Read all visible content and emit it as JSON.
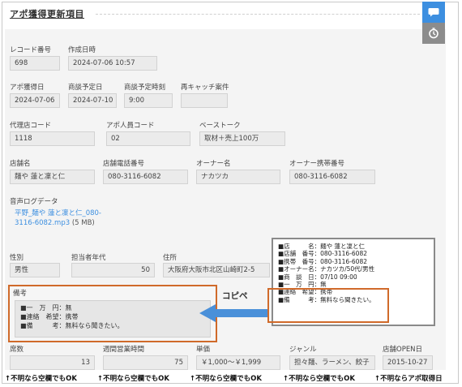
{
  "header": {
    "title": "アポ獲得更新項目"
  },
  "side_buttons": [
    {
      "icon": "chat-bubble-icon",
      "color": "#3d8fe0"
    },
    {
      "icon": "timer-icon",
      "color": "#8c8c8c"
    }
  ],
  "fields": {
    "record_no": {
      "label": "レコード番号",
      "value": "698"
    },
    "created_at": {
      "label": "作成日時",
      "value": "2024-07-06 10:57"
    },
    "appo_date": {
      "label": "アポ獲得日",
      "value": "2024-07-06"
    },
    "meeting_date": {
      "label": "商談予定日",
      "value": "2024-07-10"
    },
    "meeting_time": {
      "label": "商談予定時刻",
      "value": "9:00"
    },
    "recatch": {
      "label": "再キャッチ案件",
      "value": ""
    },
    "agency_code": {
      "label": "代理店コード",
      "value": "1118"
    },
    "appointer_code": {
      "label": "アポ人員コード",
      "value": "02"
    },
    "base_talk": {
      "label": "ベーストーク",
      "value": "取材＋売上100万"
    },
    "shop_name": {
      "label": "店舗名",
      "value": "麺や 蓮と凜と仁"
    },
    "shop_phone": {
      "label": "店舗電話番号",
      "value": "080-3116-6082"
    },
    "owner_name": {
      "label": "オーナー名",
      "value": "ナカツカ"
    },
    "owner_mobile": {
      "label": "オーナー携帯番号",
      "value": "080-3116-6082"
    },
    "audio": {
      "label": "音声ログデータ",
      "link": "平野_麺や 蓮と凜と仁_080-3116-6082.mp3",
      "size": "(5 MB)"
    },
    "gender": {
      "label": "性別",
      "value": "男性"
    },
    "age": {
      "label": "担当者年代",
      "value": "50"
    },
    "address": {
      "label": "住所",
      "value": "大阪府大阪市北区山崎町2-5"
    },
    "memo": {
      "label": "備考",
      "lines": [
        "■一　万　円：無",
        "■連絡　希望：携帯",
        "■備　　　考：無料なら聞きたい。"
      ]
    },
    "seats": {
      "label": "席数",
      "value": "13"
    },
    "weekly_hours": {
      "label": "週間営業時間",
      "value": "75"
    },
    "unit_price": {
      "label": "単価",
      "value": "￥1,000～￥1,999"
    },
    "genre": {
      "label": "ジャンル",
      "value": "担々麺、ラーメン、餃子"
    },
    "open_date": {
      "label": "店舗OPEN日",
      "value": "2015-10-27"
    }
  },
  "annotation": {
    "copy_label": "コピペ",
    "ref_lines": [
      "■店　　　名：麺や 蓮と凜と仁",
      "■店舗　番号：080-3116-6082",
      "■携帯　番号：080-3116-6082",
      "■オーナー名：ナカツカ/50代/男性",
      "■商　談　日：07/10 09:00",
      "■一　万　円：無",
      "■連絡　希望：携帯",
      "■備　　　考：無料なら聞きたい。"
    ],
    "accent_color": "#d06a2a",
    "arrow_color": "#4a90d9"
  },
  "footnotes": [
    "↑不明なら空欄でもOK",
    "↑不明なら空欄でもOK",
    "↑不明なら空欄でもOK",
    "↑不明なら空欄でもOK",
    "↑不明ならアポ取得日"
  ]
}
